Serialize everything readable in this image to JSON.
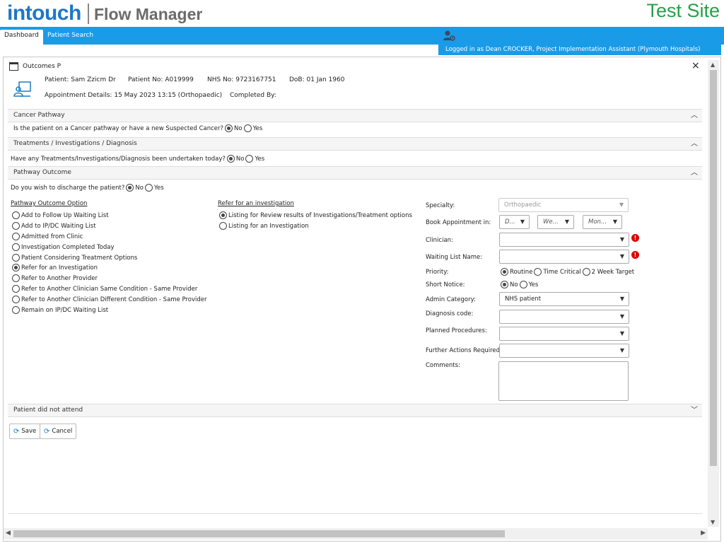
{
  "header": {
    "logo_main": "intouch",
    "logo_sub": "Flow Manager",
    "site_label": "Test Site"
  },
  "nav": {
    "tabs": [
      {
        "label": "Dashboard"
      },
      {
        "label": "Patient Search"
      }
    ],
    "logged_in": "Logged in as Dean CROCKER, Project Implementation Assistant (Plymouth Hospitals)"
  },
  "window": {
    "title": "Outcomes P",
    "close": "×"
  },
  "patient": {
    "patient_label": "Patient:",
    "patient_value": "Sam Zzicm Dr",
    "patient_no_label": "Patient No:",
    "patient_no_value": "A019999",
    "nhs_label": "NHS No:",
    "nhs_value": "9723167751",
    "dob_label": "DoB:",
    "dob_value": "01 Jan 1960",
    "appt_label": "Appointment Details:",
    "appt_value": "15 May 2023 13:15 (Orthopaedic)",
    "completed_label": "Completed By:",
    "completed_value": ""
  },
  "sections": {
    "cancer": {
      "title": "Cancer Pathway",
      "question": "Is the patient on a Cancer pathway or have a new Suspected Cancer?",
      "no": "No",
      "yes": "Yes"
    },
    "treatments": {
      "title": "Treatments / Investigations / Diagnosis",
      "question": "Have any Treatments/Investigations/Diagnosis been undertaken today?",
      "no": "No",
      "yes": "Yes"
    },
    "pathway": {
      "title": "Pathway Outcome",
      "question": "Do you wish to discharge the patient?",
      "no": "No",
      "yes": "Yes",
      "options_heading": "Pathway Outcome Option",
      "options": [
        {
          "label": "Add to Follow Up Waiting List",
          "selected": false
        },
        {
          "label": "Add to IP/DC Waiting List",
          "selected": false
        },
        {
          "label": "Admitted from Clinic",
          "selected": false
        },
        {
          "label": "Investigation Completed Today",
          "selected": false
        },
        {
          "label": "Patient Considering Treatment Options",
          "selected": false
        },
        {
          "label": "Refer for an Investigation",
          "selected": true
        },
        {
          "label": "Refer to Another Provider",
          "selected": false
        },
        {
          "label": "Refer to Another Clinician Same Condition - Same Provider",
          "selected": false
        },
        {
          "label": "Refer to Another Clinician Different Condition - Same Provider",
          "selected": false
        },
        {
          "label": "Remain on IP/DC Waiting List",
          "selected": false
        }
      ],
      "refer_heading": "Refer for an investigation",
      "refer_options": [
        {
          "label": "Listing for Review results of Investigations/Treatment options",
          "selected": true
        },
        {
          "label": "Listing for an Investigation",
          "selected": false
        }
      ],
      "form": {
        "specialty_label": "Specialty:",
        "specialty_value": "Orthopaedic",
        "book_label": "Book Appointment in:",
        "book_d": "D...",
        "book_w": "We...",
        "book_m": "Mon...",
        "clinician_label": "Clinician:",
        "clinician_value": "",
        "waiting_label": "Waiting List Name:",
        "waiting_value": "",
        "priority_label": "Priority:",
        "priority_routine": "Routine",
        "priority_time": "Time Critical",
        "priority_2week": "2 Week Target",
        "short_label": "Short Notice:",
        "short_no": "No",
        "short_yes": "Yes",
        "admin_label": "Admin Category:",
        "admin_value": "NHS patient",
        "diag_label": "Diagnosis code:",
        "diag_value": "",
        "planned_label": "Planned Procedures:",
        "planned_value": "",
        "further_label": "Further Actions Required:",
        "further_value": "",
        "comments_label": "Comments:",
        "error_mark": "!"
      }
    },
    "dna": {
      "title": "Patient did not attend"
    }
  },
  "buttons": {
    "save": "Save",
    "cancel": "Cancel"
  },
  "colors": {
    "brand_blue": "#1a9be8",
    "logo_blue": "#1f77c6",
    "test_site_green": "#27a047",
    "error_red": "#dd0000"
  }
}
